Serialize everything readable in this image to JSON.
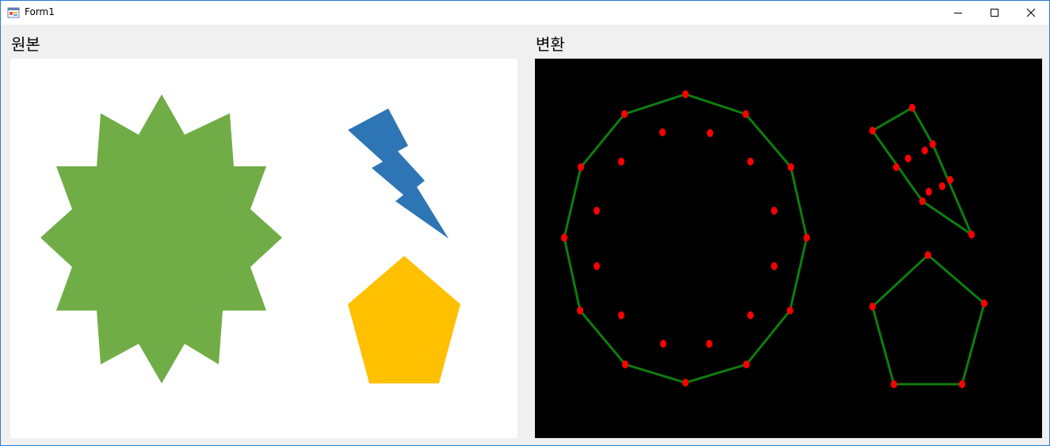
{
  "window": {
    "title": "Form1"
  },
  "labels": {
    "original": "원본",
    "transformed": "변환"
  },
  "colors": {
    "star": "#70ad47",
    "bolt": "#2e75b6",
    "pentagon": "#ffc000",
    "hull": "#0f7c0f",
    "point": "#ff0000",
    "original_bg": "#ffffff",
    "transformed_bg": "#000000"
  },
  "icons": [
    "app-icon",
    "minimize-icon",
    "maximize-icon",
    "close-icon"
  ]
}
